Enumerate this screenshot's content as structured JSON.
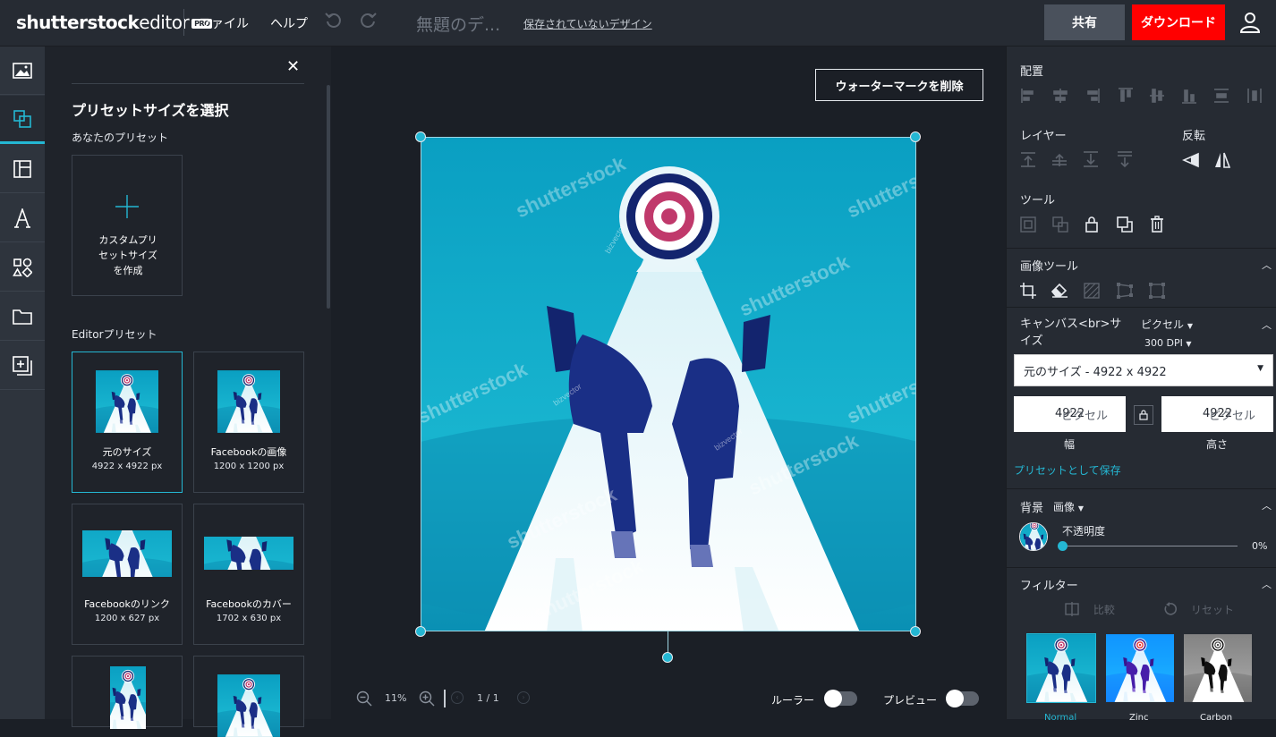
{
  "brand": {
    "name": "shutterstock",
    "product": "editor",
    "badge": "PRO"
  },
  "menu": {
    "file": "ファイル",
    "help": "ヘルプ"
  },
  "document": {
    "title": "無題のデ...",
    "status": "保存されていないデザイン"
  },
  "actions": {
    "share": "共有",
    "download": "ダウンロード"
  },
  "rail": [
    "image-icon",
    "resize-icon",
    "template-icon",
    "text-icon",
    "shapes-icon",
    "folder-icon",
    "add-page-icon"
  ],
  "preset_panel": {
    "title": "プリセットサイズを選択",
    "my_presets_label": "あなたのプリセット",
    "custom_label": "カスタムプリ\nセットサイズ\nを作成",
    "editor_presets_label": "Editorプリセット",
    "presets": [
      {
        "name": "元のサイズ",
        "dims": "4922 x 4922 px"
      },
      {
        "name": "Facebookの画像",
        "dims": "1200 x 1200 px"
      },
      {
        "name": "Facebookのリンク",
        "dims": "1200 x 627 px"
      },
      {
        "name": "Facebookのカバー",
        "dims": "1702 x 630 px"
      }
    ]
  },
  "canvas": {
    "remove_watermark": "ウォーターマークを削除",
    "watermark_text": "shutterstock",
    "credit_text": "bizvector"
  },
  "footer": {
    "zoom": "11%",
    "pages": "1 / 1",
    "ruler_label": "ルーラー",
    "preview_label": "プレビュー"
  },
  "right_panel": {
    "align_title": "配置",
    "layer_title": "レイヤー",
    "flip_title": "反転",
    "tools_title": "ツール",
    "image_tools_title": "画像ツール",
    "canvas_size_title": "キャンバス<br>サ\nイズ",
    "unit": "ピクセル",
    "dpi_value": "300",
    "dpi_label": "DPI",
    "size_select": "元のサイズ  - 4922 x 4922",
    "width_value": "4922",
    "height_value": "4922",
    "pixel_unit": "ピクセル",
    "width_label": "幅",
    "height_label": "高さ",
    "save_preset": "プリセットとして保存",
    "background_title": "背景",
    "background_type": "画像",
    "opacity_label": "不透明度",
    "opacity_value": "0%",
    "opacity_fraction": 0,
    "filters_title": "フィルター",
    "compare_label": "比較",
    "reset_label": "リセット",
    "filters": [
      "Normal",
      "Zinc",
      "Carbon"
    ]
  },
  "colors": {
    "accent": "#24b7d3",
    "download": "#ff0000",
    "sky": "#0b9bbd",
    "navy": "#0d1f6e",
    "target_pink": "#c0396b"
  }
}
